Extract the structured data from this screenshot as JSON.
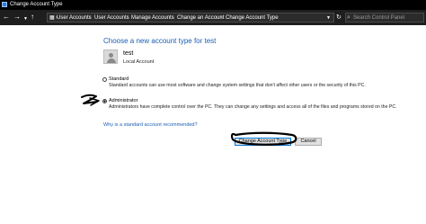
{
  "window": {
    "title": "Change Account Type"
  },
  "addressbar": {
    "breadcrumbs": [
      "User Accounts",
      "User Accounts",
      "Manage Accounts",
      "Change an Account",
      "Change Account Type"
    ],
    "search_placeholder": "Search Control Panel"
  },
  "main": {
    "heading": "Choose a new account type for test",
    "user": {
      "name": "test",
      "account_type": "Local Account"
    },
    "options": [
      {
        "label": "Standard",
        "description": "Standard accounts can use most software and change system settings that don't affect other users or the security of this PC.",
        "selected": false
      },
      {
        "label": "Administrator",
        "description": "Administrators have complete control over the PC. They can change any settings and access all of the files and programs stored on the PC.",
        "selected": true
      }
    ],
    "help_link": "Why is a standard account recommended?",
    "buttons": {
      "primary": "Change Account Type",
      "cancel": "Cancel"
    }
  },
  "colors": {
    "accent": "#1a5fb4",
    "annotation_ink": "#000000"
  }
}
